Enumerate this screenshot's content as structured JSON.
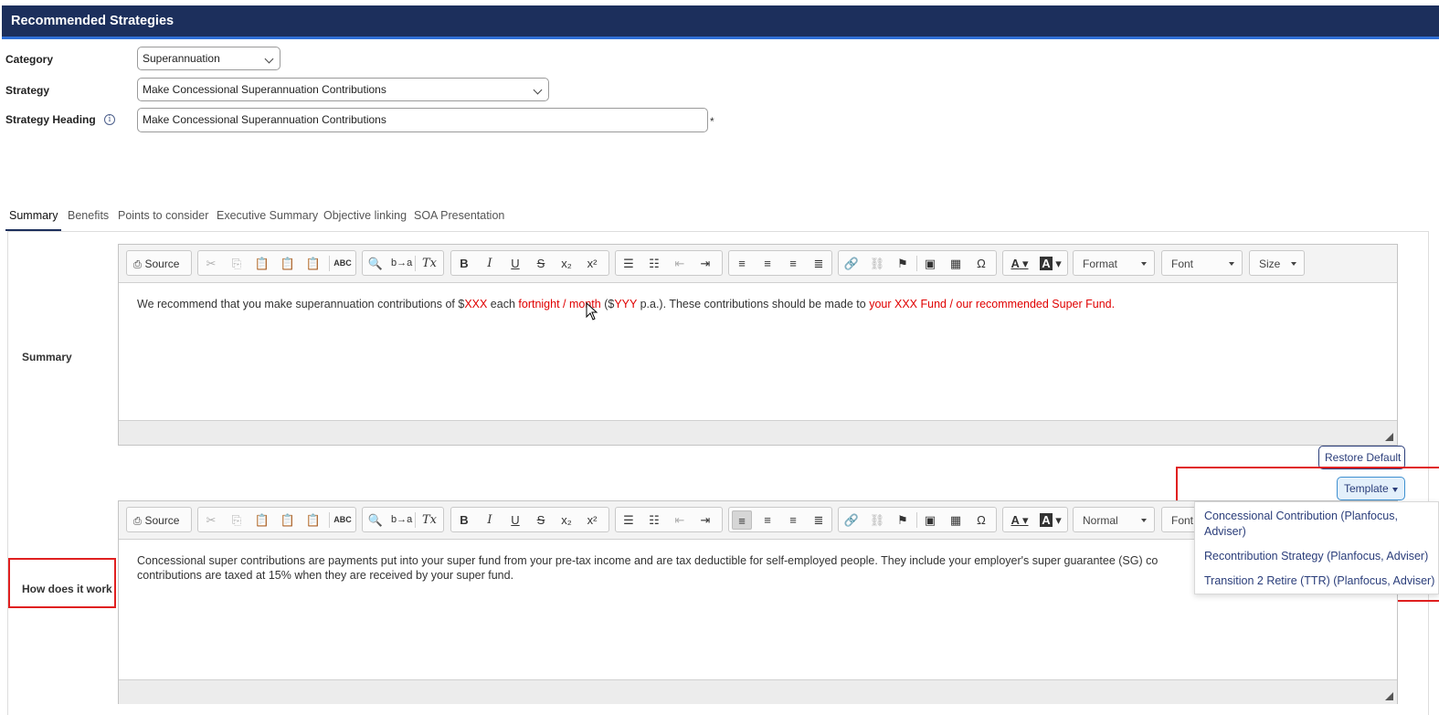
{
  "header": {
    "title": "Recommended Strategies"
  },
  "form": {
    "category_label": "Category",
    "category_value": "Superannuation",
    "strategy_label": "Strategy",
    "strategy_value": "Make Concessional Superannuation Contributions",
    "heading_label": "Strategy Heading",
    "heading_value": "Make Concessional Superannuation Contributions",
    "required_mark": "*",
    "info_glyph": "i"
  },
  "tabs": [
    {
      "label": "Summary",
      "active": true
    },
    {
      "label": "Benefits"
    },
    {
      "label": "Points to consider"
    },
    {
      "label": "Executive Summary"
    },
    {
      "label": "Objective linking"
    },
    {
      "label": "SOA Presentation"
    }
  ],
  "toolbar": {
    "source_label": "Source",
    "format_label": "Format",
    "normal_label": "Normal",
    "font_label": "Font",
    "font_label_truncated": "Font",
    "size_label": "Size",
    "bold_glyph": "B",
    "italic_glyph": "I",
    "underline_glyph": "U",
    "strike_glyph": "S",
    "clear_format_glyph": "Tx",
    "special_char_glyph": "Ω",
    "text_color_glyph": "A",
    "bg_color_glyph": "A"
  },
  "summary_section": {
    "label": "Summary",
    "content": {
      "t1": "We recommend that you make superannuation contributions of $",
      "r1": "XXX",
      "t2": " each ",
      "r2": "fortnight / month",
      "t3": " ($",
      "r3": "YYY",
      "t4": " p.a.). These contributions should be made to ",
      "r4": "your XXX Fund / our recommended Super Fund."
    }
  },
  "how_section": {
    "label": "How does it work",
    "content_line1": "Concessional super contributions are payments put into your super fund from your pre-tax income and are tax deductible for self-employed people. They include your employer's super guarantee (SG) co",
    "content_line2": "contributions are taxed at 15% when they are received by your super fund."
  },
  "buttons": {
    "restore_default": "Restore Default",
    "template": "Template"
  },
  "template_menu": [
    {
      "line1": "Concessional Contribution (Planfocus,",
      "line2": "Adviser)"
    },
    {
      "line1": "Recontribution Strategy (Planfocus, Adviser)"
    },
    {
      "line1": "Transition 2 Retire (TTR) (Planfocus, Adviser)"
    }
  ],
  "colors": {
    "header_bg": "#1c2f5c",
    "header_accent": "#2f6fd6",
    "highlight": "#e02020",
    "placeholder_text": "#e00000",
    "link": "#2a3d7a"
  }
}
